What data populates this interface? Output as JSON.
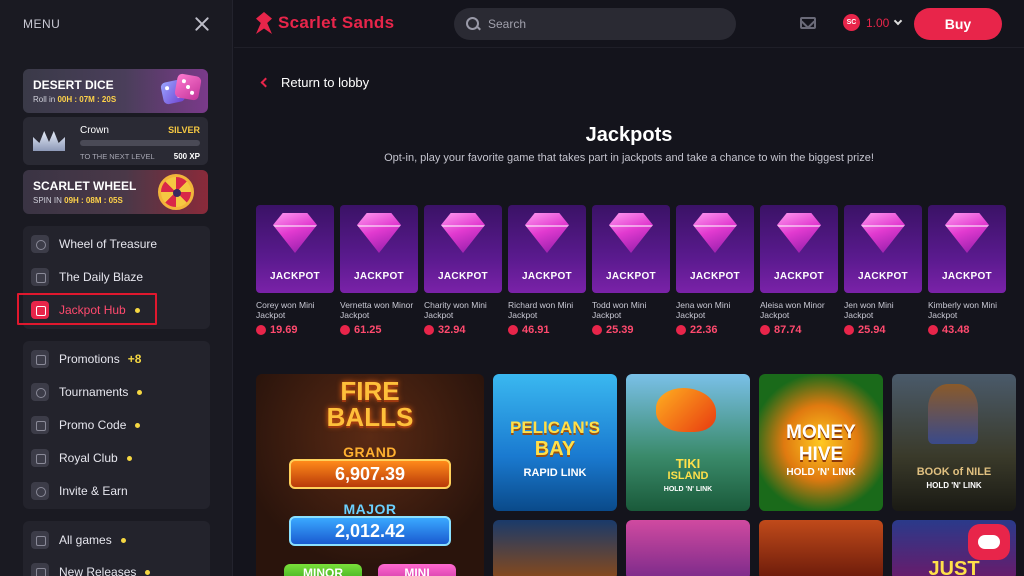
{
  "sidebar": {
    "menu_label": "MENU",
    "promo_cards": {
      "dice": {
        "title": "DESERT DICE",
        "sub_prefix": "Roll in",
        "timer": "00H : 07M : 20S"
      },
      "crown": {
        "label": "Crown",
        "tier": "SILVER",
        "next": "TO THE NEXT LEVEL",
        "xp": "500 XP"
      },
      "wheel": {
        "title": "SCARLET WHEEL",
        "sub_prefix": "SPIN IN",
        "timer": "09H : 08M : 05S"
      }
    },
    "group1": [
      {
        "label": "Wheel of Treasure",
        "icon": "wheel-icon"
      },
      {
        "label": "The Daily Blaze",
        "icon": "calendar-icon"
      },
      {
        "label": "Jackpot Hub",
        "icon": "jackpot-icon",
        "active": true,
        "dot": true
      }
    ],
    "group2": [
      {
        "label": "Promotions",
        "icon": "gift-icon",
        "badge": "+8"
      },
      {
        "label": "Tournaments",
        "icon": "trophy-icon",
        "dot": true
      },
      {
        "label": "Promo Code",
        "icon": "tag-icon",
        "dot": true
      },
      {
        "label": "Royal Club",
        "icon": "crown-icon",
        "dot": true
      },
      {
        "label": "Invite & Earn",
        "icon": "users-icon"
      }
    ],
    "group3": [
      {
        "label": "All games",
        "icon": "gamepad-icon",
        "dot": true
      },
      {
        "label": "New Releases",
        "icon": "sparkle-icon",
        "dot": true
      }
    ]
  },
  "header": {
    "brand": "Scarlet Sands",
    "search_placeholder": "Search",
    "coin_label": "SC",
    "balance": "1.00",
    "buy_label": "Buy"
  },
  "main": {
    "return_label": "Return to lobby",
    "title": "Jackpots",
    "subtitle": "Opt-in, play your favorite game that takes part in jackpots and take a chance to win the biggest prize!",
    "jackpot_tag": "JACKPOT",
    "jackpots": [
      {
        "text": "Corey won Mini Jackpot",
        "amount": "19.69"
      },
      {
        "text": "Vernetta won Minor Jackpot",
        "amount": "61.25"
      },
      {
        "text": "Charity won Mini Jackpot",
        "amount": "32.94"
      },
      {
        "text": "Richard won Mini Jackpot",
        "amount": "46.91"
      },
      {
        "text": "Todd won Mini Jackpot",
        "amount": "25.39"
      },
      {
        "text": "Jena won Mini Jackpot",
        "amount": "22.36"
      },
      {
        "text": "Aleisa won Minor Jackpot",
        "amount": "87.74"
      },
      {
        "text": "Jen won Mini Jackpot",
        "amount": "25.94"
      },
      {
        "text": "Kimberly won Mini Jackpot",
        "amount": "43.48"
      }
    ],
    "featured": {
      "title_line1": "FIRE",
      "title_line2": "BALLS",
      "grand_label": "GRAND",
      "grand_value": "6,907.39",
      "major_label": "MAJOR",
      "major_value": "2,012.42",
      "minor_label": "MINOR",
      "mini_label": "MINI"
    },
    "games": [
      {
        "line1": "PELICAN'S",
        "line2": "BAY",
        "line3": "RAPID LINK"
      },
      {
        "line1": "TIKI",
        "line2": "ISLAND",
        "line3": "HOLD 'N' LINK"
      },
      {
        "line1": "MONEY",
        "line2": "HIVE",
        "line3": "HOLD 'N' LINK"
      },
      {
        "line1": "BOOK of NILE",
        "line2": "",
        "line3": "HOLD 'N' LINK"
      }
    ],
    "second_row_partial": "JUST"
  }
}
